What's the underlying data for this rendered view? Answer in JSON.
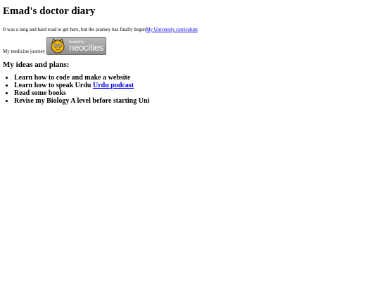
{
  "page": {
    "title": "Emad's doctor diary",
    "intro_text": "It was a long and hard road to get here, but the journey has finally begun",
    "curriculum_link": "My University curriculum",
    "journey_text": "My medicine journey",
    "badge": {
      "top_text": "hosted by",
      "brand_text": "neocities",
      "icon": "neocities-cat-icon"
    },
    "section_heading": "My ideas and plans:",
    "plans": [
      {
        "text": "Learn how to code and make a website",
        "link": ""
      },
      {
        "text": "Learn how to speak Urdu ",
        "link": "Urdu podcast"
      },
      {
        "text": "Read some books",
        "link": ""
      },
      {
        "text": "Revise my Biology A level before starting Uni",
        "link": ""
      }
    ]
  },
  "colors": {
    "link": "#0000ee",
    "badge_bg": "#a3a3a3",
    "text": "#000000"
  }
}
